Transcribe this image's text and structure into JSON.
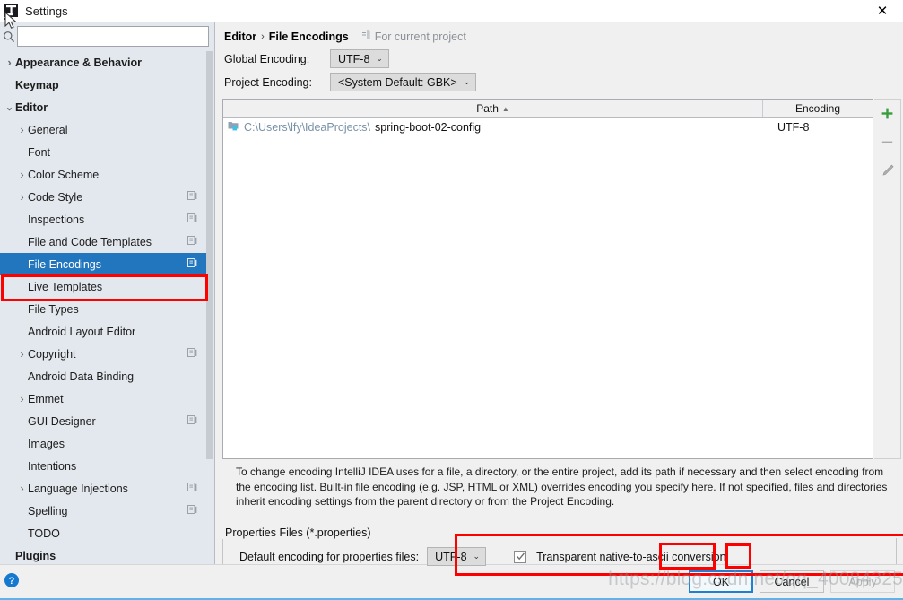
{
  "window": {
    "title": "Settings",
    "icon": "intellij-idea-icon",
    "close_label": "✕"
  },
  "sidebar": {
    "search": {
      "placeholder": "",
      "value": "",
      "icon": "search-icon"
    },
    "items": [
      {
        "label": "Appearance & Behavior",
        "level": 0,
        "expandable": true,
        "expanded": false,
        "badge": false,
        "selected": false
      },
      {
        "label": "Keymap",
        "level": 0,
        "expandable": false,
        "expanded": false,
        "badge": false,
        "selected": false
      },
      {
        "label": "Editor",
        "level": 0,
        "expandable": true,
        "expanded": true,
        "badge": false,
        "selected": false
      },
      {
        "label": "General",
        "level": 1,
        "expandable": true,
        "expanded": false,
        "badge": false,
        "selected": false
      },
      {
        "label": "Font",
        "level": 1,
        "expandable": false,
        "expanded": false,
        "badge": false,
        "selected": false
      },
      {
        "label": "Color Scheme",
        "level": 1,
        "expandable": true,
        "expanded": false,
        "badge": false,
        "selected": false
      },
      {
        "label": "Code Style",
        "level": 1,
        "expandable": true,
        "expanded": false,
        "badge": true,
        "selected": false
      },
      {
        "label": "Inspections",
        "level": 1,
        "expandable": false,
        "expanded": false,
        "badge": true,
        "selected": false
      },
      {
        "label": "File and Code Templates",
        "level": 1,
        "expandable": false,
        "expanded": false,
        "badge": true,
        "selected": false
      },
      {
        "label": "File Encodings",
        "level": 1,
        "expandable": false,
        "expanded": false,
        "badge": true,
        "selected": true
      },
      {
        "label": "Live Templates",
        "level": 1,
        "expandable": false,
        "expanded": false,
        "badge": false,
        "selected": false
      },
      {
        "label": "File Types",
        "level": 1,
        "expandable": false,
        "expanded": false,
        "badge": false,
        "selected": false
      },
      {
        "label": "Android Layout Editor",
        "level": 1,
        "expandable": false,
        "expanded": false,
        "badge": false,
        "selected": false
      },
      {
        "label": "Copyright",
        "level": 1,
        "expandable": true,
        "expanded": false,
        "badge": true,
        "selected": false
      },
      {
        "label": "Android Data Binding",
        "level": 1,
        "expandable": false,
        "expanded": false,
        "badge": false,
        "selected": false
      },
      {
        "label": "Emmet",
        "level": 1,
        "expandable": true,
        "expanded": false,
        "badge": false,
        "selected": false
      },
      {
        "label": "GUI Designer",
        "level": 1,
        "expandable": false,
        "expanded": false,
        "badge": true,
        "selected": false
      },
      {
        "label": "Images",
        "level": 1,
        "expandable": false,
        "expanded": false,
        "badge": false,
        "selected": false
      },
      {
        "label": "Intentions",
        "level": 1,
        "expandable": false,
        "expanded": false,
        "badge": false,
        "selected": false
      },
      {
        "label": "Language Injections",
        "level": 1,
        "expandable": true,
        "expanded": false,
        "badge": true,
        "selected": false
      },
      {
        "label": "Spelling",
        "level": 1,
        "expandable": false,
        "expanded": false,
        "badge": true,
        "selected": false
      },
      {
        "label": "TODO",
        "level": 1,
        "expandable": false,
        "expanded": false,
        "badge": false,
        "selected": false
      },
      {
        "label": "Plugins",
        "level": 0,
        "expandable": false,
        "expanded": false,
        "badge": false,
        "selected": false
      }
    ]
  },
  "main": {
    "breadcrumb": {
      "root": "Editor",
      "separator": "›",
      "current": "File Encodings",
      "scope_note": "For current project",
      "scope_icon": "project-scope-icon"
    },
    "global_encoding": {
      "label": "Global Encoding:",
      "value": "UTF-8",
      "caret": "⌄"
    },
    "project_encoding": {
      "label": "Project Encoding:",
      "value": "<System Default: GBK>",
      "caret": "⌄"
    },
    "table": {
      "columns": [
        "Path",
        "Encoding"
      ],
      "sort_column": "Path",
      "sort_indicator": "▲",
      "rows": [
        {
          "icon": "module-folder-icon",
          "path_prefix": "C:\\Users\\lfy\\IdeaProjects\\",
          "path_leaf": "spring-boot-02-config",
          "encoding": "UTF-8"
        }
      ]
    },
    "tools": [
      {
        "name": "add-button",
        "glyph": "+",
        "color": "#389e3d"
      },
      {
        "name": "remove-button",
        "glyph": "−",
        "color": "#9a9a9a"
      },
      {
        "name": "edit-button",
        "glyph": "✎",
        "color": "#9a9a9a"
      }
    ],
    "help_text": "To change encoding IntelliJ IDEA uses for a file, a directory, or the entire project, add its path if necessary and then select encoding from the encoding list. Built-in file encoding (e.g. JSP, HTML or XML) overrides encoding you specify here. If not specified, files and directories inherit encoding settings from the parent directory or from the Project Encoding.",
    "properties_group": {
      "title": "Properties Files (*.properties)",
      "default_encoding_label": "Default encoding for properties files:",
      "default_encoding_value": "UTF-8",
      "default_encoding_caret": "⌄",
      "transparent_label": "Transparent native-to-ascii conversion",
      "transparent_checked": true
    }
  },
  "footer": {
    "help_icon": "help-question-icon",
    "buttons": [
      {
        "label": "OK",
        "style": "default",
        "enabled": true
      },
      {
        "label": "Cancel",
        "style": "normal",
        "enabled": true
      },
      {
        "label": "Apply",
        "style": "disabled",
        "enabled": false
      }
    ]
  },
  "overlay": {
    "watermark": "https://blog.csdn.net/qq_40084325",
    "highlights": [
      "file-encodings-sidebar-item",
      "properties-files-row",
      "properties-encoding-combo",
      "transparent-checkbox"
    ]
  },
  "colors": {
    "selection_blue": "#2176bd",
    "highlight_red": "#ff0000",
    "sidebar_bg": "#e3e8ee",
    "panel_bg": "#f0f0f0",
    "add_green": "#389e3d",
    "path_blue": "#7892a8"
  }
}
